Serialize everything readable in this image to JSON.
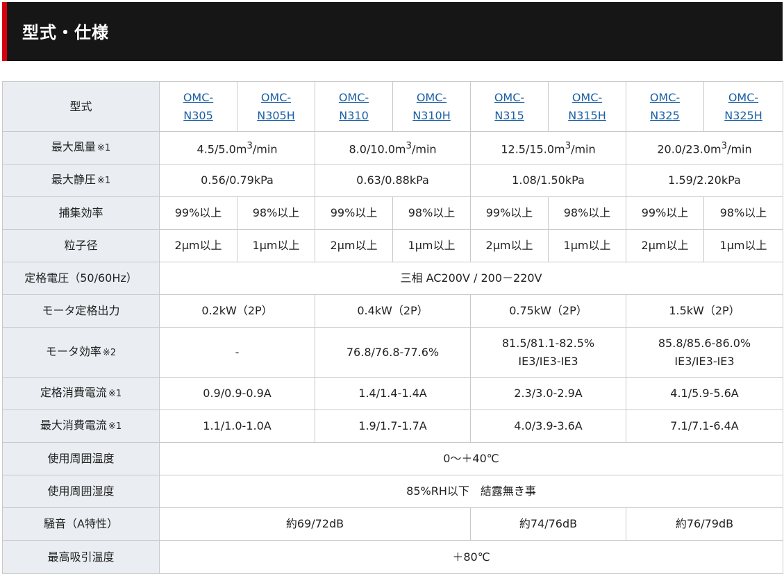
{
  "header": {
    "title": "型式・仕様"
  },
  "table": {
    "rows": [
      {
        "label": "型式",
        "note": "",
        "cells": [
          {
            "l1": "OMC-",
            "l2": "N305"
          },
          {
            "l1": "OMC-",
            "l2": "N305H"
          },
          {
            "l1": "OMC-",
            "l2": "N310"
          },
          {
            "l1": "OMC-",
            "l2": "N310H"
          },
          {
            "l1": "OMC-",
            "l2": "N315"
          },
          {
            "l1": "OMC-",
            "l2": "N315H"
          },
          {
            "l1": "OMC-",
            "l2": "N325"
          },
          {
            "l1": "OMC-",
            "l2": "N325H"
          }
        ]
      },
      {
        "label": "最大風量",
        "note": "※1",
        "cells": [
          {
            "pre": "4.5/5.0m",
            "post": "/min"
          },
          {
            "pre": "8.0/10.0m",
            "post": "/min"
          },
          {
            "pre": "12.5/15.0m",
            "post": "/min"
          },
          {
            "pre": "20.0/23.0m",
            "post": "/min"
          }
        ],
        "sup": "3"
      },
      {
        "label": "最大静圧",
        "note": "※1",
        "cells": [
          "0.56/0.79kPa",
          "0.63/0.88kPa",
          "1.08/1.50kPa",
          "1.59/2.20kPa"
        ]
      },
      {
        "label": "捕集効率",
        "note": "",
        "cells": [
          "99%以上",
          "98%以上",
          "99%以上",
          "98%以上",
          "99%以上",
          "98%以上",
          "99%以上",
          "98%以上"
        ]
      },
      {
        "label": "粒子径",
        "note": "",
        "cells": [
          "2μm以上",
          "1μm以上",
          "2μm以上",
          "1μm以上",
          "2μm以上",
          "1μm以上",
          "2μm以上",
          "1μm以上"
        ]
      },
      {
        "label": "定格電圧（50/60Hz）",
        "note": "",
        "cells": [
          "三相 AC200V / 200－220V"
        ]
      },
      {
        "label": "モータ定格出力",
        "note": "",
        "cells": [
          "0.2kW（2P）",
          "0.4kW（2P）",
          "0.75kW（2P）",
          "1.5kW（2P）"
        ]
      },
      {
        "label": "モータ効率",
        "note": "※2",
        "cells": [
          {
            "l1": "-",
            "l2": ""
          },
          {
            "l1": "76.8/76.8-77.6%",
            "l2": ""
          },
          {
            "l1": "81.5/81.1-82.5%",
            "l2": "IE3/IE3-IE3"
          },
          {
            "l1": "85.8/85.6-86.0%",
            "l2": "IE3/IE3-IE3"
          }
        ]
      },
      {
        "label": "定格消費電流",
        "note": "※1",
        "cells": [
          "0.9/0.9-0.9A",
          "1.4/1.4-1.4A",
          "2.3/3.0-2.9A",
          "4.1/5.9-5.6A"
        ]
      },
      {
        "label": "最大消費電流",
        "note": "※1",
        "cells": [
          "1.1/1.0-1.0A",
          "1.9/1.7-1.7A",
          "4.0/3.9-3.6A",
          "7.1/7.1-6.4A"
        ]
      },
      {
        "label": "使用周囲温度",
        "note": "",
        "cells": [
          "0～＋40℃"
        ]
      },
      {
        "label": "使用周囲湿度",
        "note": "",
        "cells": [
          "85%RH以下　結露無き事"
        ]
      },
      {
        "label": "騒音（A特性）",
        "note": "",
        "cells": [
          "約69/72dB",
          "約74/76dB",
          "約76/79dB"
        ]
      },
      {
        "label": "最高吸引温度",
        "note": "",
        "cells": [
          "＋80℃"
        ]
      }
    ]
  },
  "colors": {
    "header_bg": "#161616",
    "accent": "#d7000f",
    "label_bg": "#eaeef2",
    "link": "#1a5fa5"
  }
}
